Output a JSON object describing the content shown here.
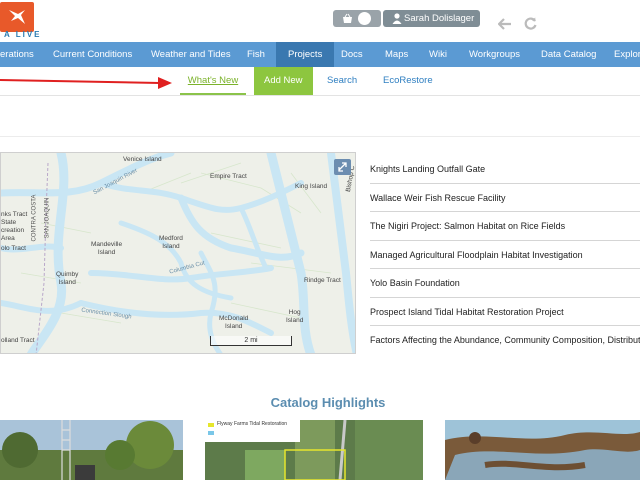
{
  "header": {
    "logo_text": "A LIVE",
    "user_name": "Sarah Dolislager",
    "icons": [
      "basket-icon",
      "user-icon",
      "back-arrow-icon",
      "refresh-icon"
    ]
  },
  "main_nav": {
    "items": [
      {
        "label": "erations"
      },
      {
        "label": "Current Conditions"
      },
      {
        "label": "Weather and Tides"
      },
      {
        "label": "Fish"
      },
      {
        "label": "Projects",
        "active": true
      },
      {
        "label": "Docs"
      },
      {
        "label": "Maps"
      },
      {
        "label": "Wiki"
      },
      {
        "label": "Workgroups"
      },
      {
        "label": "Data Catalog"
      },
      {
        "label": "Explor"
      }
    ]
  },
  "sub_nav": {
    "whats_new": "What's New",
    "add_new": "Add New",
    "search": "Search",
    "ecorestore": "EcoRestore"
  },
  "map": {
    "labels": {
      "venice_island": "Venice Island",
      "empire_tract": "Empire Tract",
      "king_island": "King Island",
      "bishop": "Bishop C",
      "san_joaquin_river": "San Joaquin River",
      "contra_costa": "CONTRA COSTA",
      "san_joaquin": "SAN JOAQUIN",
      "nks_tract": "nks Tract",
      "state": "State",
      "recreation": "creation",
      "area": "Area",
      "olo_tract": "olo Tract",
      "mandeville": "Mandeville",
      "mandeville2": "Island",
      "medford": "Medford",
      "medford2": "Island",
      "quimby": "Quimby",
      "quimby2": "Island",
      "columbia_cut": "Columbia Cut",
      "connection_slough": "Connection Slough",
      "rindge_tract": "Rindge Tract",
      "mcdonald": "McDonald",
      "mcdonald2": "Island",
      "hog": "Hog",
      "hog2": "Island",
      "olland_tract": "olland Tract",
      "scale": "2 mi"
    },
    "colors": {
      "water": "#c9e6f4",
      "land": "#eef0e9",
      "field_lines": "#d6e8c8"
    }
  },
  "projects": [
    "Knights Landing Outfall Gate",
    "Wallace Weir Fish Rescue Facility",
    "The Nigiri Project: Salmon Habitat on Rice Fields",
    "Managed Agricultural Floodplain Habitat Investigation",
    "Yolo Basin Foundation",
    "Prospect Island Tidal Habitat Restoration Project",
    "Factors Affecting the Abundance, Community Composition, Distributi"
  ],
  "catalog": {
    "title": "Catalog Highlights",
    "thumb2_caption": "Flyway Farms Tidal Restoration"
  },
  "colors": {
    "nav_blue": "#5b9ad3",
    "nav_active": "#3a78b0",
    "accent_green": "#8dc63f",
    "logo_orange": "#e8592a",
    "annotation_red": "#e02020"
  }
}
